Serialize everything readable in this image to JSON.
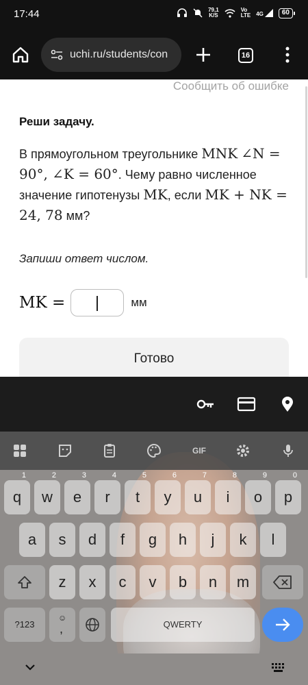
{
  "status_bar": {
    "time": "17:44",
    "speed_value": "79,1",
    "speed_unit": "K/S",
    "network_top": "Vo",
    "network_bottom": "LTE",
    "network_gen": "4G",
    "battery": "60"
  },
  "browser": {
    "url": "uchi.ru/students/con",
    "tab_count": "16"
  },
  "page": {
    "report_link": "Сообщить об ошибке",
    "task_title": "Реши задачу.",
    "problem": {
      "t1": "В прямоугольном треугольнике ",
      "m1": "MNK",
      "m2": "∠N = 90°, ∠K = 60°",
      "t2": ". Чему равно численное значение гипотенузы ",
      "m3": "MK",
      "t3": ", если ",
      "m4": "MK + NK = 24, 78",
      "t4": " мм?"
    },
    "hint": "Запиши ответ числом.",
    "answer_label": "MK =",
    "answer_value": "",
    "answer_unit": "мм",
    "done_button": "Готово"
  },
  "keyboard": {
    "toolbar": [
      "apps-icon",
      "sticker-icon",
      "clipboard-icon",
      "palette-icon",
      "GIF",
      "settings-icon",
      "mic-icon"
    ],
    "row1": [
      {
        "k": "q",
        "n": "1"
      },
      {
        "k": "w",
        "n": "2"
      },
      {
        "k": "e",
        "n": "3"
      },
      {
        "k": "r",
        "n": "4"
      },
      {
        "k": "t",
        "n": "5"
      },
      {
        "k": "y",
        "n": "6"
      },
      {
        "k": "u",
        "n": "7"
      },
      {
        "k": "i",
        "n": "8"
      },
      {
        "k": "o",
        "n": "9"
      },
      {
        "k": "p",
        "n": "0"
      }
    ],
    "row2": [
      "a",
      "s",
      "d",
      "f",
      "g",
      "h",
      "j",
      "k",
      "l"
    ],
    "row3": [
      "z",
      "x",
      "c",
      "v",
      "b",
      "n",
      "m"
    ],
    "symbols_key": "?123",
    "comma_key": ",",
    "space_label": "QWERTY"
  }
}
